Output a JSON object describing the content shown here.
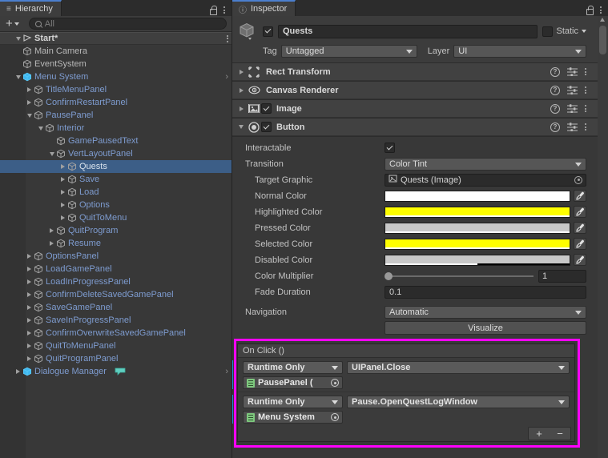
{
  "hierarchy": {
    "tab_label": "Hierarchy",
    "tab_icon": "hierarchy-icon",
    "lock_icon": "lock-icon",
    "menu_icon": "kebab-menu-icon",
    "toolbar": {
      "add_label": "+",
      "search_placeholder": "All",
      "search_value": ""
    },
    "scene": {
      "name": "Start*",
      "expanded": true
    },
    "items": [
      {
        "label": "Main Camera",
        "depth": 2,
        "arrow": "none",
        "style": "plain",
        "icon": "gameobject-cube-icon"
      },
      {
        "label": "EventSystem",
        "depth": 2,
        "arrow": "none",
        "style": "plain",
        "icon": "gameobject-cube-icon"
      },
      {
        "label": "Menu System",
        "depth": 2,
        "arrow": "down",
        "style": "prefab",
        "icon": "prefab-cube-icon",
        "trailing": "chevron"
      },
      {
        "label": "TitleMenuPanel",
        "depth": 3,
        "arrow": "right",
        "style": "prefab",
        "icon": "gameobject-cube-icon"
      },
      {
        "label": "ConfirmRestartPanel",
        "depth": 3,
        "arrow": "right",
        "style": "prefab",
        "icon": "gameobject-cube-icon"
      },
      {
        "label": "PausePanel",
        "depth": 3,
        "arrow": "down",
        "style": "prefab",
        "icon": "gameobject-cube-icon"
      },
      {
        "label": "Interior",
        "depth": 4,
        "arrow": "down",
        "style": "prefab",
        "icon": "gameobject-cube-icon"
      },
      {
        "label": "GamePausedText",
        "depth": 5,
        "arrow": "none",
        "style": "prefab",
        "icon": "gameobject-cube-icon"
      },
      {
        "label": "VertLayoutPanel",
        "depth": 5,
        "arrow": "down",
        "style": "prefab",
        "icon": "gameobject-cube-icon"
      },
      {
        "label": "Quests",
        "depth": 6,
        "arrow": "right",
        "style": "prefab",
        "icon": "gameobject-cube-icon",
        "selected": true
      },
      {
        "label": "Save",
        "depth": 6,
        "arrow": "right",
        "style": "prefab",
        "icon": "gameobject-cube-icon"
      },
      {
        "label": "Load",
        "depth": 6,
        "arrow": "right",
        "style": "prefab",
        "icon": "gameobject-cube-icon"
      },
      {
        "label": "Options",
        "depth": 6,
        "arrow": "right",
        "style": "prefab",
        "icon": "gameobject-cube-icon"
      },
      {
        "label": "QuitToMenu",
        "depth": 6,
        "arrow": "right",
        "style": "prefab",
        "icon": "gameobject-cube-icon"
      },
      {
        "label": "QuitProgram",
        "depth": 5,
        "arrow": "right",
        "style": "prefab",
        "icon": "gameobject-cube-icon"
      },
      {
        "label": "Resume",
        "depth": 5,
        "arrow": "right",
        "style": "prefab",
        "icon": "gameobject-cube-icon"
      },
      {
        "label": "OptionsPanel",
        "depth": 3,
        "arrow": "right",
        "style": "prefab",
        "icon": "gameobject-cube-icon"
      },
      {
        "label": "LoadGamePanel",
        "depth": 3,
        "arrow": "right",
        "style": "prefab",
        "icon": "gameobject-cube-icon"
      },
      {
        "label": "LoadInProgressPanel",
        "depth": 3,
        "arrow": "right",
        "style": "prefab",
        "icon": "gameobject-cube-icon"
      },
      {
        "label": "ConfirmDeleteSavedGamePanel",
        "depth": 3,
        "arrow": "right",
        "style": "prefab",
        "icon": "gameobject-cube-icon"
      },
      {
        "label": "SaveGamePanel",
        "depth": 3,
        "arrow": "right",
        "style": "prefab",
        "icon": "gameobject-cube-icon"
      },
      {
        "label": "SaveInProgressPanel",
        "depth": 3,
        "arrow": "right",
        "style": "prefab",
        "icon": "gameobject-cube-icon"
      },
      {
        "label": "ConfirmOverwriteSavedGamePanel",
        "depth": 3,
        "arrow": "right",
        "style": "prefab",
        "icon": "gameobject-cube-icon"
      },
      {
        "label": "QuitToMenuPanel",
        "depth": 3,
        "arrow": "right",
        "style": "prefab",
        "icon": "gameobject-cube-icon"
      },
      {
        "label": "QuitProgramPanel",
        "depth": 3,
        "arrow": "right",
        "style": "prefab",
        "icon": "gameobject-cube-icon"
      },
      {
        "label": "Dialogue Manager",
        "depth": 2,
        "arrow": "right",
        "style": "prefab",
        "icon": "prefab-cube-icon",
        "badge": "dialogue-bubble-icon",
        "trailing": "chevron"
      }
    ]
  },
  "inspector": {
    "tab_label": "Inspector",
    "tab_icon": "info-icon",
    "lock_icon": "lock-icon",
    "menu_icon": "kebab-menu-icon",
    "header": {
      "object_icon": "gameobject-cube-icon",
      "enabled": true,
      "name": "Quests",
      "static_label": "Static",
      "static_checked": false,
      "tag_label": "Tag",
      "tag_value": "Untagged",
      "layer_label": "Layer",
      "layer_value": "UI"
    },
    "components": [
      {
        "title": "Rect Transform",
        "icon": "rect-transform-icon",
        "expanded": false,
        "has_toggle": false
      },
      {
        "title": "Canvas Renderer",
        "icon": "eye-icon",
        "expanded": false,
        "has_toggle": false
      },
      {
        "title": "Image",
        "icon": "image-icon",
        "expanded": false,
        "has_toggle": true,
        "enabled": true
      },
      {
        "title": "Button",
        "icon": "button-circle-icon",
        "expanded": true,
        "has_toggle": true,
        "enabled": true
      }
    ],
    "button_component": {
      "interactable_label": "Interactable",
      "interactable_checked": true,
      "transition_label": "Transition",
      "transition_value": "Color Tint",
      "target_graphic_label": "Target Graphic",
      "target_graphic_value": "Quests (Image)",
      "colors": [
        {
          "label": "Normal Color",
          "hex": "#ffffff",
          "alpha": 100
        },
        {
          "label": "Highlighted Color",
          "hex": "#ffff00",
          "alpha": 100
        },
        {
          "label": "Pressed Color",
          "hex": "#c8c8c8",
          "alpha": 100
        },
        {
          "label": "Selected Color",
          "hex": "#ffff00",
          "alpha": 100
        },
        {
          "label": "Disabled Color",
          "hex": "#c8c8c8",
          "alpha": 50
        }
      ],
      "color_multiplier_label": "Color Multiplier",
      "color_multiplier_value": "1",
      "fade_duration_label": "Fade Duration",
      "fade_duration_value": "0.1",
      "navigation_label": "Navigation",
      "navigation_value": "Automatic",
      "visualize_label": "Visualize"
    },
    "on_click": {
      "title": "On Click ()",
      "highlight_color": "#ff00ff",
      "override_color": "#2494d8",
      "entries": [
        {
          "mode": "Runtime Only",
          "function": "UIPanel.Close",
          "target": "PausePanel (",
          "target_icon": "script-icon"
        },
        {
          "mode": "Runtime Only",
          "function": "Pause.OpenQuestLogWindow",
          "target": "Menu System",
          "target_icon": "script-icon"
        }
      ],
      "add_label": "+",
      "remove_label": "−"
    }
  }
}
